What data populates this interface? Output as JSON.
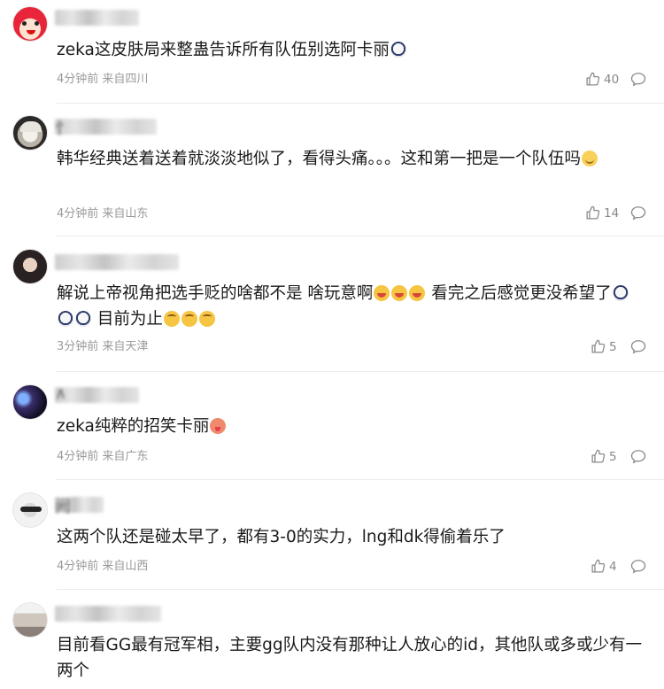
{
  "comments": [
    {
      "author_char": "",
      "parts": [
        {
          "text": "zeka这皮肤局来整蛊告诉所有队伍别选阿卡丽"
        },
        {
          "emoji": "shock-emoji"
        }
      ],
      "meta": "4分钟前 来自四川",
      "likes": "40",
      "avatar": "avatar-pink-doll"
    },
    {
      "author_char": "忄",
      "parts": [
        {
          "text": "韩华经典送着送着就淡淡地似了，看得头痛。。。这和第一把是一个队伍吗"
        },
        {
          "emoji": "smile-emoji"
        }
      ],
      "meta": "4分钟前 来自山东",
      "likes": "14",
      "avatar": "avatar-anime-white-hair"
    },
    {
      "author_char": "",
      "parts": [
        {
          "text": "解说上帝视角把选手贬的啥都不是 啥玩意啊"
        },
        {
          "emoji": "laugh-emoji"
        },
        {
          "emoji": "laugh-emoji"
        },
        {
          "emoji": "laugh-emoji"
        },
        {
          "text": " 看完之后感觉更没希望了"
        },
        {
          "emoji": "shock-emoji"
        },
        {
          "emoji": "shock-emoji"
        },
        {
          "emoji": "shock-emoji"
        },
        {
          "text": " 目前为止"
        },
        {
          "emoji": "grin-emoji"
        },
        {
          "emoji": "grin-emoji"
        },
        {
          "emoji": "grin-emoji"
        }
      ],
      "meta": "3分钟前 来自天津",
      "likes": "5",
      "avatar": "avatar-girl-dark"
    },
    {
      "author_char": "∧",
      "parts": [
        {
          "text": "zeka纯粹的招笑卡丽"
        },
        {
          "emoji": "tongue-emoji"
        }
      ],
      "meta": "4分钟前 来自广东",
      "likes": "5",
      "avatar": "avatar-space-scene"
    },
    {
      "author_char": "阙",
      "parts": [
        {
          "text": "这两个队还是碰太早了，都有3-0的实力，lng和dk得偷着乐了"
        }
      ],
      "meta": "4分钟前 来自山西",
      "likes": "4",
      "avatar": "avatar-sunglasses"
    },
    {
      "author_char": "",
      "parts": [
        {
          "text": "目前看GG最有冠军相，主要gg队内没有那种让人放心的id，其他队或多或少有一两个"
        }
      ],
      "meta": "",
      "likes": "",
      "avatar": "avatar-poster"
    }
  ],
  "colors": {
    "text": "#1a1a1a",
    "meta": "#9a9a9a",
    "divider": "#ececec"
  }
}
